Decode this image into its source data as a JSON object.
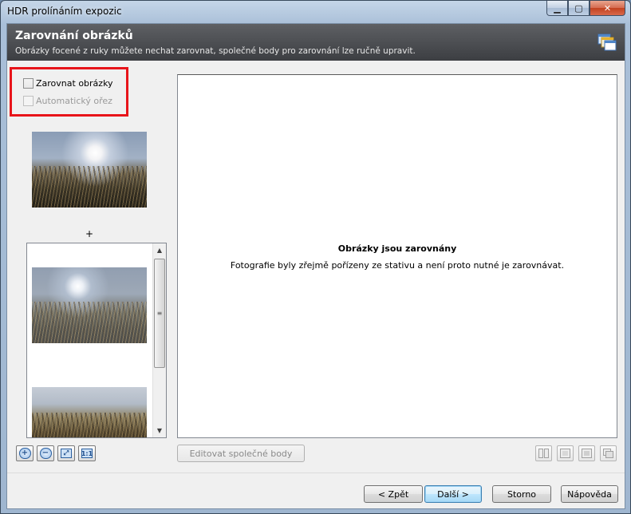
{
  "window": {
    "title": "HDR prolínáním expozic",
    "minimize_glyph": "▁",
    "maximize_glyph": "▢",
    "close_glyph": "✕"
  },
  "header": {
    "title": "Zarovnání obrázků",
    "subtitle": "Obrázky focené z ruky můžete nechat zarovnat, společné body pro zarovnání lze ručně upravit.",
    "icon": "windows-stack-icon"
  },
  "options": {
    "align_label": "Zarovnat obrázky",
    "align_checked": false,
    "autocrop_label": "Automatický ořez",
    "autocrop_checked": false,
    "autocrop_enabled": false
  },
  "left_panel": {
    "plus": "+",
    "scroll_grip": "≡",
    "scroll_up": "▲",
    "scroll_down": "▼"
  },
  "zoom_buttons": {
    "zoom_in": "+",
    "zoom_out": "−",
    "fit": "⤢",
    "actual_size": "1:1"
  },
  "preview": {
    "title": "Obrázky jsou zarovnány",
    "message": "Fotografie byly zřejmě pořízeny ze stativu a není proto nutné je zarovnávat."
  },
  "edit_points_label": "Editovat společné body",
  "footer": {
    "back_label": "< Zpět",
    "next_label": "Další >",
    "cancel_label": "Storno",
    "help_label": "Nápověda"
  },
  "colors": {
    "highlight_border": "#e8141a",
    "header_background": "#3c3e42",
    "default_button": "#3c7fb1"
  }
}
